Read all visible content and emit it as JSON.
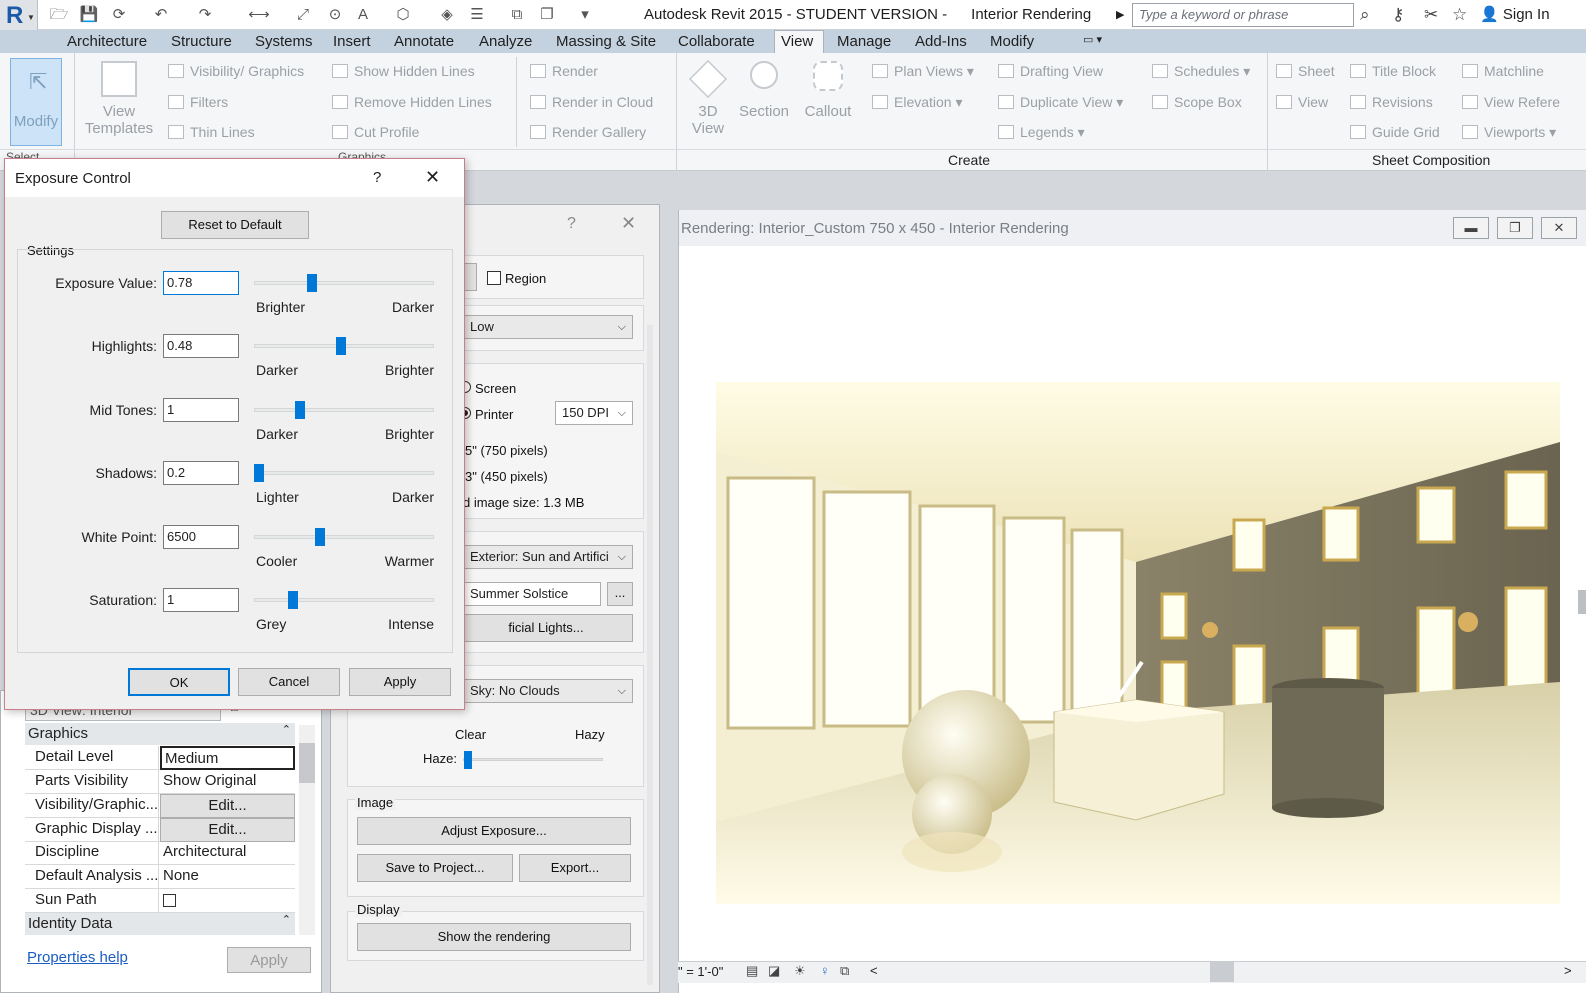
{
  "app": {
    "title": "Autodesk Revit 2015 - STUDENT VERSION -",
    "doc": "Interior Rendering",
    "search_placeholder": "Type a keyword or phrase",
    "sign_in": "Sign In"
  },
  "tabs": [
    "Architecture",
    "Structure",
    "Systems",
    "Insert",
    "Annotate",
    "Analyze",
    "Massing & Site",
    "Collaborate",
    "View",
    "Manage",
    "Add-Ins",
    "Modify"
  ],
  "ribbon": {
    "modify": "Modify",
    "view_templates": [
      "View",
      "Templates"
    ],
    "graphics": [
      "Visibility/ Graphics",
      "Filters",
      "Thin Lines",
      "Show Hidden Lines",
      "Remove Hidden Lines",
      "Cut Profile"
    ],
    "render": [
      "Render",
      "Render in Cloud",
      "Render Gallery"
    ],
    "threeD": [
      "3D",
      "View"
    ],
    "section": "Section",
    "callout": "Callout",
    "create": [
      "Plan Views",
      "Elevation",
      "Drafting View",
      "Duplicate View",
      "Legends",
      "Schedules",
      "Scope Box"
    ],
    "sheet": [
      "Sheet",
      "View",
      "Title Block",
      "Revisions",
      "Guide Grid",
      "Matchline",
      "View Refere",
      "Viewports"
    ],
    "panel_select": "Select",
    "panel_graphics": "Graphics",
    "panel_create": "Create",
    "panel_sheet": "Sheet Composition"
  },
  "render_window": {
    "title": "Rendering: Interior_Custom 750 x 450 - Interior Rendering",
    "scale": "\" = 1'-0\""
  },
  "render_dialog": {
    "region": "Region",
    "quality": "Low",
    "screen": "Screen",
    "printer": "Printer",
    "dpi": "150 DPI",
    "width": "5\" (750 pixels)",
    "height": "3\" (450 pixels)",
    "image_size": "d image size:  1.3 MB",
    "scheme": "Exterior: Sun and Artifici",
    "sun": "Summer Solstice",
    "more": "...",
    "lights": "ficial Lights...",
    "sky": "Sky: No Clouds",
    "clear": "Clear",
    "hazy": "Hazy",
    "haze": "Haze:",
    "haze_level": 0,
    "image_label": "Image",
    "adjust": "Adjust Exposure...",
    "save": "Save to Project...",
    "export": "Export...",
    "display_label": "Display",
    "show": "Show the rendering",
    "help": "?",
    "close": "✕"
  },
  "properties": {
    "header": "3D View: Interior",
    "section_graphics": "Graphics",
    "rows": [
      {
        "k": "Detail Level",
        "v": "Medium"
      },
      {
        "k": "Parts Visibility",
        "v": "Show Original"
      },
      {
        "k": "Visibility/Graphic...",
        "v": "Edit..."
      },
      {
        "k": "Graphic Display ...",
        "v": "Edit..."
      },
      {
        "k": "Discipline",
        "v": "Architectural"
      },
      {
        "k": "Default Analysis ...",
        "v": "None"
      },
      {
        "k": "Sun Path",
        "v": ""
      }
    ],
    "section_identity": "Identity Data",
    "help": "Properties help",
    "apply": "Apply"
  },
  "exposure": {
    "title": "Exposure Control",
    "help": "?",
    "close": "✕",
    "reset": "Reset to Default",
    "settings": "Settings",
    "rows": [
      {
        "label": "Exposure Value:",
        "value": "0.78",
        "left": "Brighter",
        "right": "Darker",
        "pos": 0.31
      },
      {
        "label": "Highlights:",
        "value": "0.48",
        "left": "Darker",
        "right": "Brighter",
        "pos": 0.48
      },
      {
        "label": "Mid Tones:",
        "value": "1",
        "left": "Darker",
        "right": "Brighter",
        "pos": 0.24
      },
      {
        "label": "Shadows:",
        "value": "0.2",
        "left": "Lighter",
        "right": "Darker",
        "pos": 0.0
      },
      {
        "label": "White Point:",
        "value": "6500",
        "left": "Cooler",
        "right": "Warmer",
        "pos": 0.36
      },
      {
        "label": "Saturation:",
        "value": "1",
        "left": "Grey",
        "right": "Intense",
        "pos": 0.2
      }
    ],
    "ok": "OK",
    "cancel": "Cancel",
    "apply": "Apply"
  }
}
